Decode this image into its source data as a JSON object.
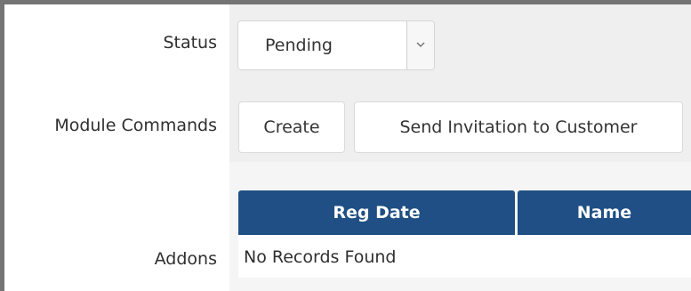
{
  "form": {
    "status": {
      "label": "Status",
      "selected_value": "Pending",
      "arrow_icon": "chevron-down-icon"
    },
    "module_commands": {
      "label": "Module Commands",
      "buttons": [
        {
          "label": "Create"
        },
        {
          "label": "Send Invitation to Customer"
        }
      ]
    },
    "addons": {
      "label": "Addons",
      "table": {
        "columns": [
          "Reg Date",
          "Name"
        ],
        "empty_message": "No Records Found"
      }
    }
  },
  "colors": {
    "table_header": "#1f4f84",
    "field_background": "#efefef",
    "frame_border": "#747474"
  }
}
